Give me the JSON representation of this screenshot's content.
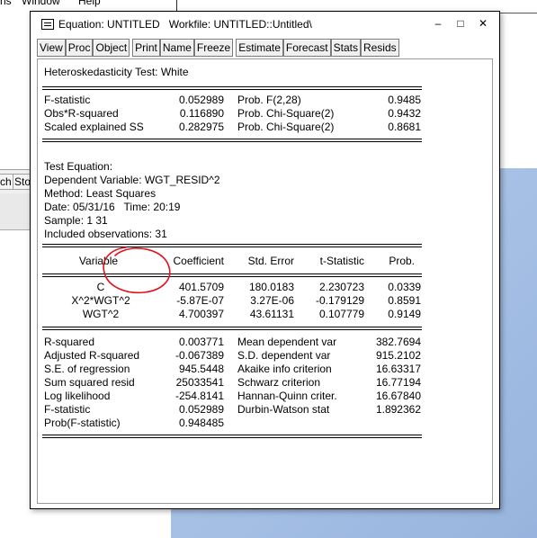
{
  "background": {
    "menu_fragment_1": "ns",
    "menu_fragment_2": "Window",
    "menu_fragment_3": "Help",
    "toolbar_fragment_1": "ch",
    "toolbar_fragment_2": "Sto"
  },
  "window": {
    "title": "Equation: UNTITLED   Workfile: UNTITLED::Untitled\\",
    "minimize": "–",
    "maximize": "□",
    "close": "✕",
    "icon": "equation-window-icon"
  },
  "toolbar": {
    "buttons": [
      "View",
      "Proc",
      "Object",
      "Print",
      "Name",
      "Freeze",
      "Estimate",
      "Forecast",
      "Stats",
      "Resids"
    ]
  },
  "output": {
    "heading": "Heteroskedasticity Test: White",
    "tests": [
      {
        "label": "F-statistic",
        "value": "0.052989",
        "prob_label": "Prob. F(2,28)",
        "prob": "0.9485"
      },
      {
        "label": "Obs*R-squared",
        "value": "0.116890",
        "prob_label": "Prob. Chi-Square(2)",
        "prob": "0.9432"
      },
      {
        "label": "Scaled explained SS",
        "value": "0.282975",
        "prob_label": "Prob. Chi-Square(2)",
        "prob": "0.8681"
      }
    ],
    "info": {
      "test_equation": "Test Equation:",
      "dependent": "Dependent Variable: WGT_RESID^2",
      "method": "Method: Least Squares",
      "date": "Date: 05/31/16   Time: 20:19",
      "sample": "Sample: 1 31",
      "included": "Included observations: 31"
    },
    "coef_headers": [
      "Variable",
      "Coefficient",
      "Std. Error",
      "t-Statistic",
      "Prob."
    ],
    "coef_rows": [
      {
        "var": "C",
        "coef": "401.5709",
        "se": "180.0183",
        "t": "2.230723",
        "p": "0.0339"
      },
      {
        "var": "X^2*WGT^2",
        "coef": "-5.87E-07",
        "se": "3.27E-06",
        "t": "-0.179129",
        "p": "0.8591"
      },
      {
        "var": "WGT^2",
        "coef": "4.700397",
        "se": "43.61131",
        "t": "0.107779",
        "p": "0.9149"
      }
    ],
    "stats_left": [
      {
        "label": "R-squared",
        "value": "0.003771"
      },
      {
        "label": "Adjusted R-squared",
        "value": "-0.067389"
      },
      {
        "label": "S.E. of regression",
        "value": "945.5448"
      },
      {
        "label": "Sum squared resid",
        "value": "25033541"
      },
      {
        "label": "Log likelihood",
        "value": "-254.8141"
      },
      {
        "label": "F-statistic",
        "value": "0.052989"
      },
      {
        "label": "Prob(F-statistic)",
        "value": "0.948485"
      }
    ],
    "stats_right": [
      {
        "label": "Mean dependent var",
        "value": "382.7694"
      },
      {
        "label": "S.D. dependent var",
        "value": "915.2102"
      },
      {
        "label": "Akaike info criterion",
        "value": "16.63317"
      },
      {
        "label": "Schwarz criterion",
        "value": "16.77194"
      },
      {
        "label": "Hannan-Quinn criter.",
        "value": "16.67840"
      },
      {
        "label": "Durbin-Watson stat",
        "value": "1.892362"
      }
    ]
  },
  "annotation": {
    "color": "#e0141e"
  }
}
